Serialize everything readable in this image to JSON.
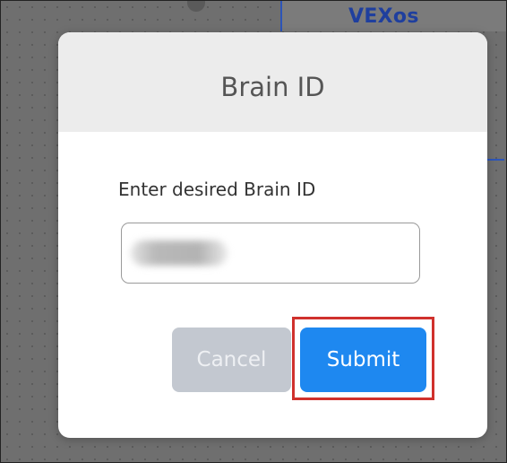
{
  "background": {
    "app_title": "VEXos"
  },
  "dialog": {
    "title": "Brain ID",
    "prompt": "Enter desired Brain ID",
    "input_value_redacted": true,
    "cancel_label": "Cancel",
    "submit_label": "Submit"
  },
  "colors": {
    "submit_button": "#1e88f0",
    "cancel_button": "#c3c8d0",
    "highlight_box": "#d0312d",
    "title_text": "#1f3f9e"
  }
}
